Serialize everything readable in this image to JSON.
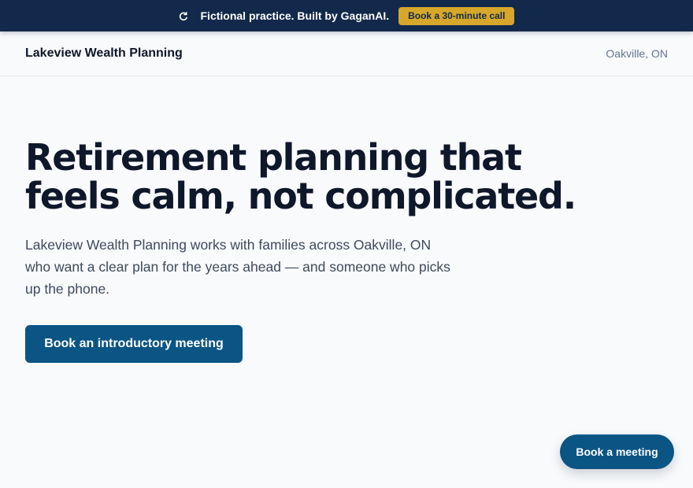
{
  "topbar": {
    "icon": "refresh-circle-icon",
    "text": "Fictional practice. Built by GaganAI.",
    "cta_label": "Book a 30-minute call"
  },
  "header": {
    "brand": "Lakeview Wealth Planning",
    "location": "Oakville, ON"
  },
  "hero": {
    "title_line1": "Retirement planning that",
    "title_line2": "feels calm, not complicated.",
    "subtitle_line1": "Lakeview Wealth Planning works with families across Oakville, ON",
    "subtitle_line2": "who want a clear plan for the years ahead — and someone who picks",
    "subtitle_line3": "up the phone.",
    "cta_label": "Book an introductory meeting"
  },
  "floating_cta": {
    "label": "Book a meeting"
  },
  "colors": {
    "topbar_bg": "#13294b",
    "accent_gold": "#d6a72a",
    "primary_blue": "#0b5585",
    "page_bg": "#f8fafc"
  }
}
